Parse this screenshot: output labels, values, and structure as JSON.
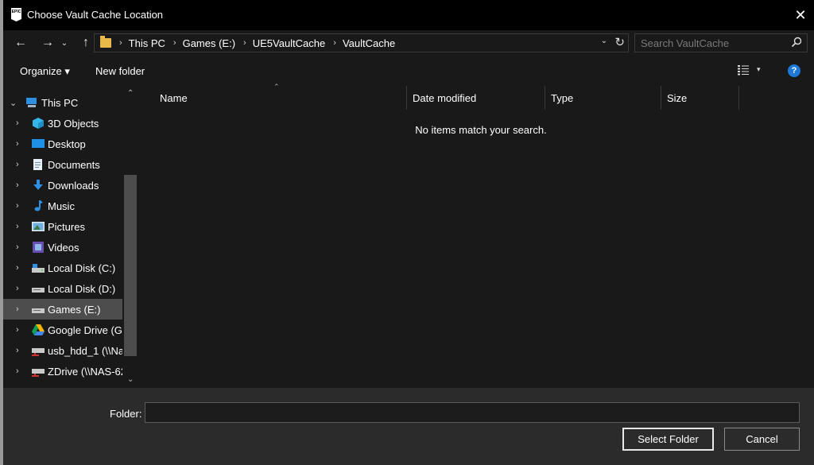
{
  "window": {
    "title": "Choose Vault Cache Location",
    "app_logo_text": "EPIC",
    "close_symbol": "✕"
  },
  "nav": {
    "back_symbol": "←",
    "forward_symbol": "→",
    "recent_symbol": "⌄",
    "up_symbol": "↑",
    "breadcrumb": [
      "This PC",
      "Games (E:)",
      "UE5VaultCache",
      "VaultCache"
    ],
    "separator": "›",
    "dropdown_symbol": "⌄",
    "refresh_symbol": "↻"
  },
  "search": {
    "placeholder": "Search VaultCache",
    "value": ""
  },
  "toolbar": {
    "organize_label": "Organize ▾",
    "new_folder_label": "New folder",
    "view_dropdown_symbol": "▾",
    "help_label": "?"
  },
  "sidebar": {
    "items": [
      {
        "label": "This PC",
        "chevron": "⌄",
        "icon": "pc-icon"
      },
      {
        "label": "3D Objects",
        "chevron": "›",
        "icon": "cube-icon"
      },
      {
        "label": "Desktop",
        "chevron": "›",
        "icon": "desktop-icon"
      },
      {
        "label": "Documents",
        "chevron": "›",
        "icon": "document-icon"
      },
      {
        "label": "Downloads",
        "chevron": "›",
        "icon": "download-icon"
      },
      {
        "label": "Music",
        "chevron": "›",
        "icon": "music-icon"
      },
      {
        "label": "Pictures",
        "chevron": "›",
        "icon": "picture-icon"
      },
      {
        "label": "Videos",
        "chevron": "›",
        "icon": "video-icon"
      },
      {
        "label": "Local Disk (C:)",
        "chevron": "›",
        "icon": "system-drive-icon"
      },
      {
        "label": "Local Disk (D:)",
        "chevron": "›",
        "icon": "drive-icon"
      },
      {
        "label": "Games (E:)",
        "chevron": "›",
        "icon": "drive-icon"
      },
      {
        "label": "Google Drive (G:",
        "chevron": "›",
        "icon": "google-drive-icon"
      },
      {
        "label": "usb_hdd_1 (\\\\Na",
        "chevron": "›",
        "icon": "network-drive-icon"
      },
      {
        "label": "ZDrive (\\\\NAS-62",
        "chevron": "›",
        "icon": "network-drive-icon"
      }
    ],
    "selected_index": 10,
    "scroll_up_symbol": "⌃",
    "scroll_down_symbol": "⌄"
  },
  "list": {
    "columns": [
      "Name",
      "Date modified",
      "Type",
      "Size"
    ],
    "sort_symbol": "⌃",
    "empty_message": "No items match your search."
  },
  "footer": {
    "folder_label": "Folder:",
    "folder_value": "",
    "select_button": "Select Folder",
    "cancel_button": "Cancel"
  },
  "colors": {
    "background": "#191919",
    "titlebar": "#000000",
    "footer": "#2b2b2b",
    "selection": "#4d4d4d",
    "help_blue": "#1e78d8",
    "folder_yellow": "#e9b94a"
  }
}
